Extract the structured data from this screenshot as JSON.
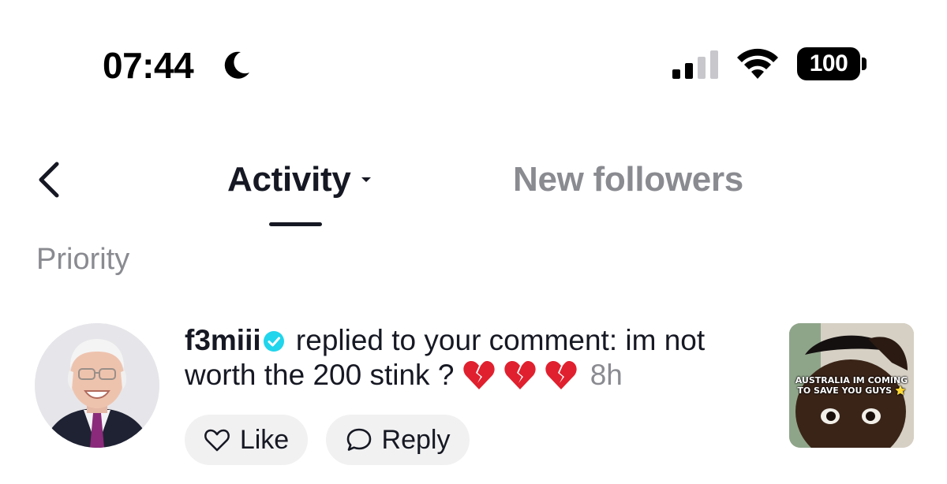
{
  "status_bar": {
    "time": "07:44",
    "battery": "100",
    "icons": [
      "moon-icon",
      "signal-icon",
      "wifi-icon"
    ]
  },
  "header": {
    "back_icon": "chevron-left-icon",
    "tabs": [
      {
        "label": "Activity",
        "active": true,
        "dropdown": true
      },
      {
        "label": "New followers",
        "active": false
      }
    ]
  },
  "section": {
    "title": "Priority"
  },
  "notification": {
    "username": "f3miii",
    "verified": true,
    "message": " replied to your comment: im not worth the 200 stink ? ",
    "emojis": [
      "broken-heart-icon",
      "broken-heart-icon",
      "broken-heart-icon"
    ],
    "time_ago": "8h",
    "like_label": "Like",
    "reply_label": "Reply",
    "thumbnail_caption": "AUSTRALIA IM COMING TO SAVE YOU GUYS ⭐"
  },
  "colors": {
    "text_primary": "#161823",
    "text_secondary": "#8a8b91",
    "button_bg": "#f1f1f2",
    "verified": "#20d5ec",
    "broken_heart": "#e0202e"
  }
}
